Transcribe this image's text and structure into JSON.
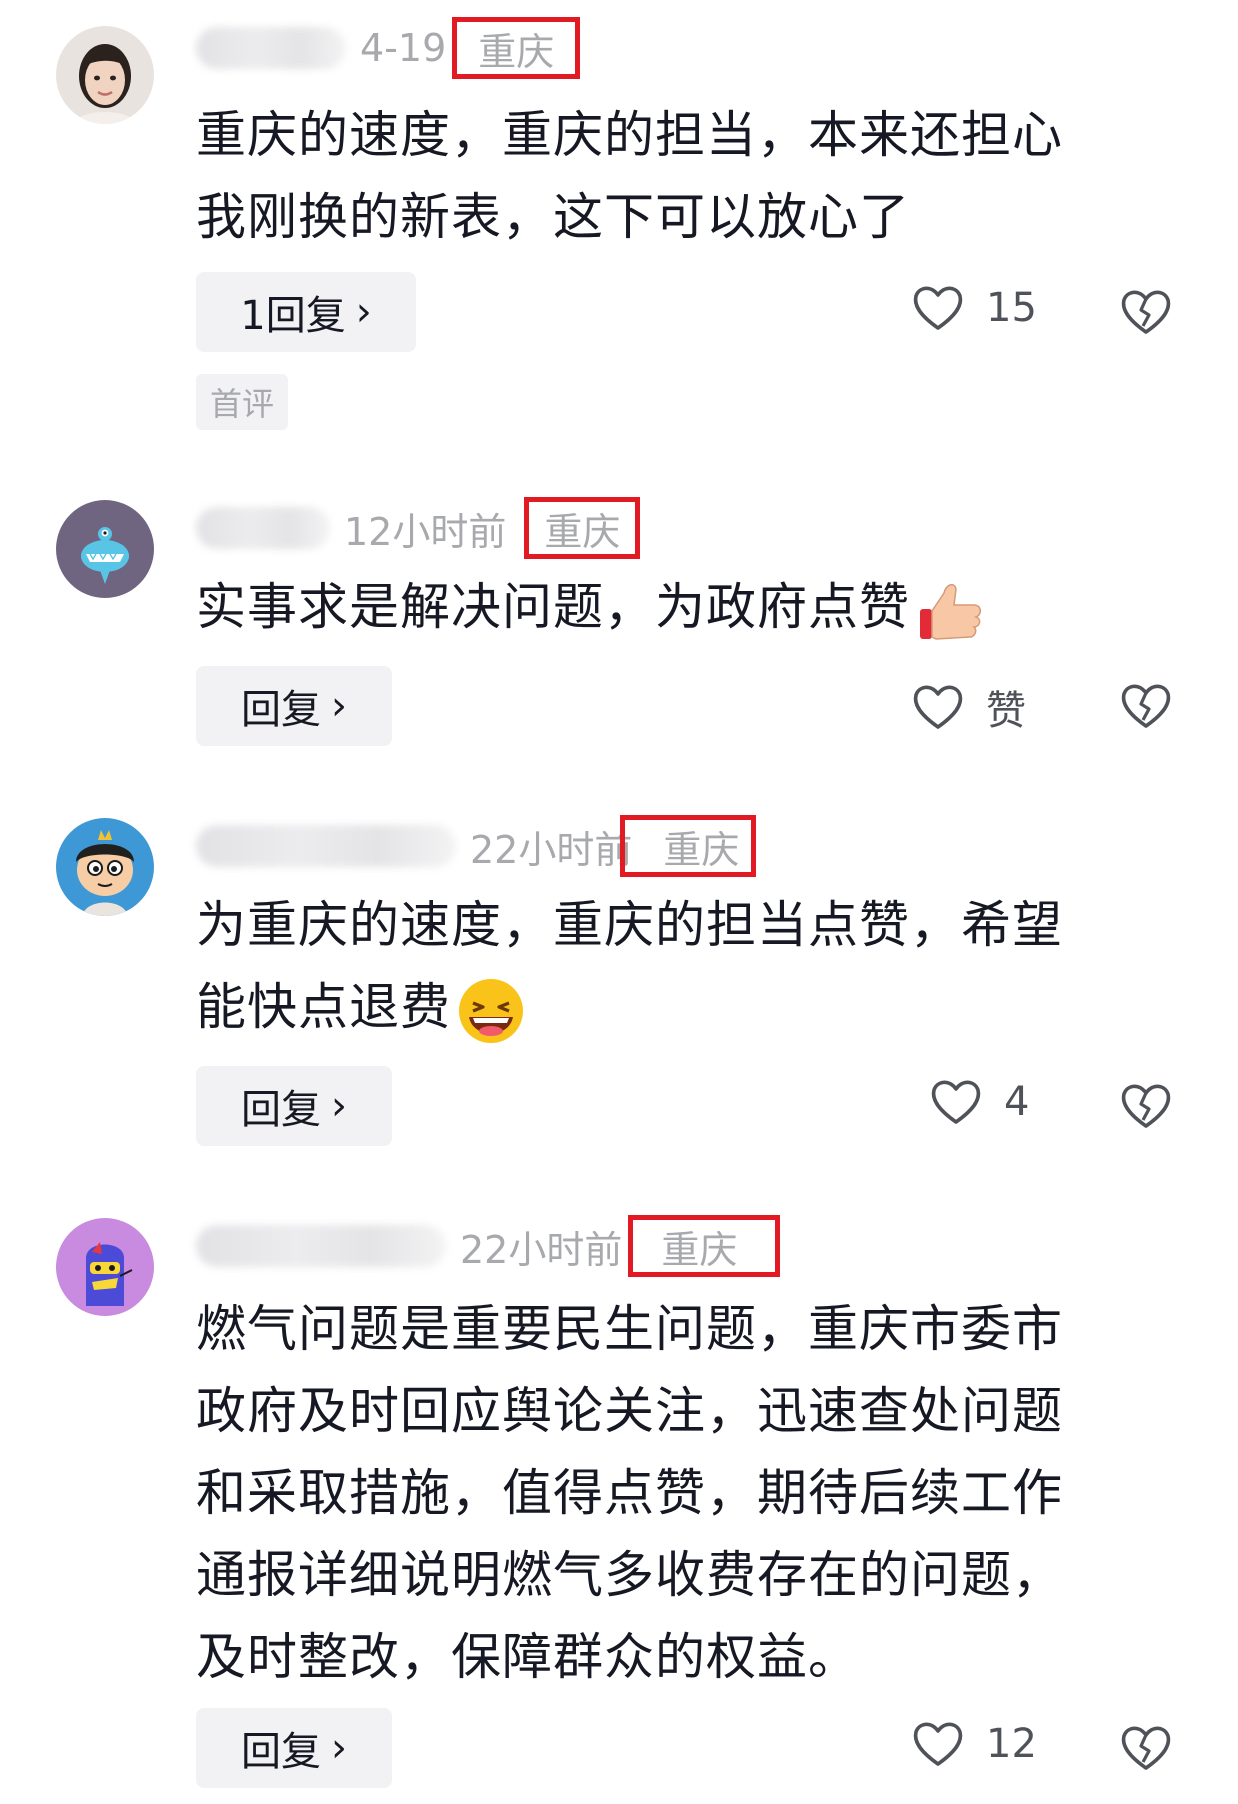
{
  "comments": [
    {
      "time": "4-19",
      "region": "重庆",
      "text_lines": [
        "重庆的速度，重庆的担当，本来还担心",
        "我刚换的新表，这下可以放心了"
      ],
      "reply_label": "1回复",
      "like_count": "15",
      "tag": "首评"
    },
    {
      "time": "12小时前",
      "region": "重庆",
      "text_lines": [
        "实事求是解决问题，为政府点赞"
      ],
      "emoji": "thumbs-up",
      "reply_label": "回复",
      "like_count": "赞"
    },
    {
      "time": "22小时前",
      "region": "重庆",
      "text_lines": [
        "为重庆的速度，重庆的担当点赞，希望",
        "能快点退费"
      ],
      "emoji": "laughing-face",
      "reply_label": "回复",
      "like_count": "4"
    },
    {
      "time": "22小时前",
      "region": "重庆",
      "text_lines": [
        "燃气问题是重要民生问题，重庆市委市",
        "政府及时回应舆论关注，迅速查处问题",
        "和采取措施，值得点赞，期待后续工作",
        "通报详细说明燃气多收费存在的问题，",
        "及时整改，保障群众的权益。"
      ],
      "reply_label": "回复",
      "like_count": "12"
    }
  ],
  "colors": {
    "highlight_box": "#e11a24",
    "meta_text": "#a8a9ad",
    "button_bg": "#f2f2f4"
  }
}
